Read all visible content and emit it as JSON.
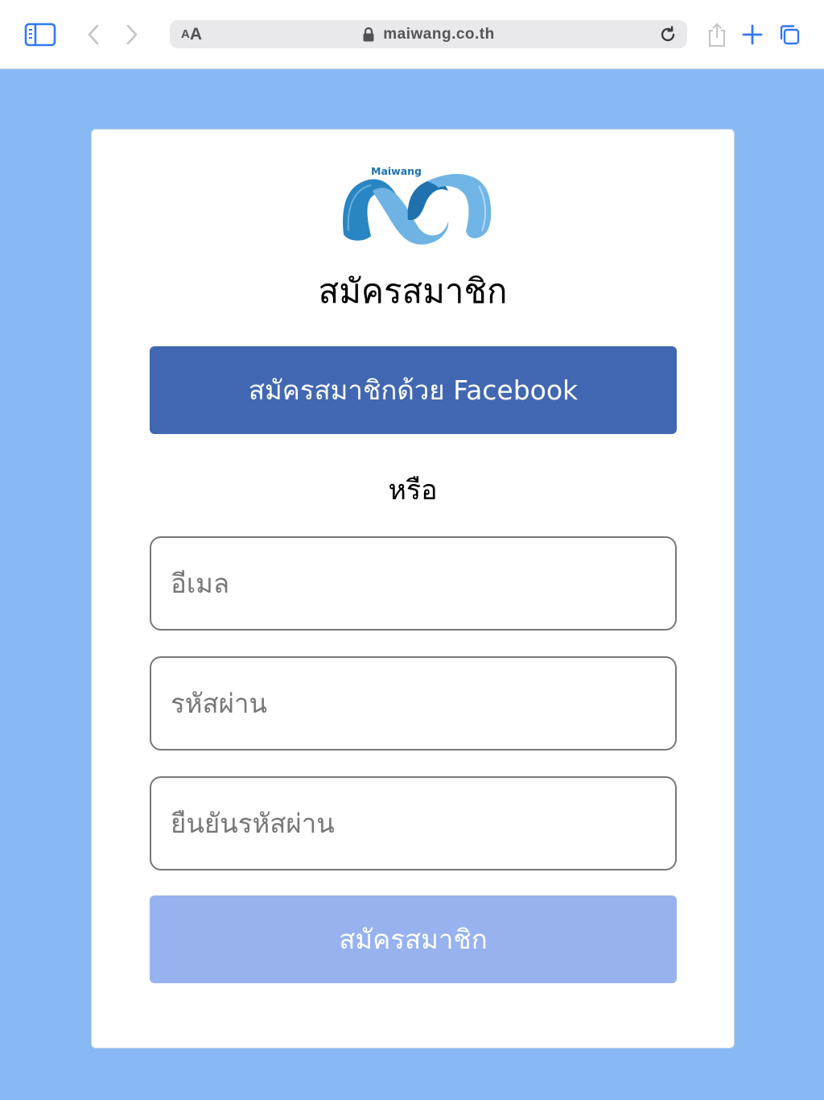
{
  "browser": {
    "text_size_label_small": "A",
    "text_size_label_big": "A",
    "url": "maiwang.co.th",
    "icons": {
      "sidebar": "sidebar-icon",
      "back": "chevron-left-icon",
      "forward": "chevron-right-icon",
      "lock": "lock-icon",
      "reload": "reload-icon",
      "share": "share-icon",
      "new_tab": "plus-icon",
      "tabs": "tabs-icon"
    },
    "accent_color": "#3478f6"
  },
  "page": {
    "background_color": "#88b9f5",
    "logo_text": "Maiwang",
    "title": "สมัครสมาชิก",
    "facebook_button": "สมัครสมาชิกด้วย Facebook",
    "facebook_color": "#4267b2",
    "or_text": "หรือ",
    "email_placeholder": "อีเมล",
    "password_placeholder": "รหัสผ่าน",
    "confirm_password_placeholder": "ยืนยันรหัสผ่าน",
    "submit_button": "สมัครสมาชิก",
    "submit_color": "#97b2ef"
  }
}
